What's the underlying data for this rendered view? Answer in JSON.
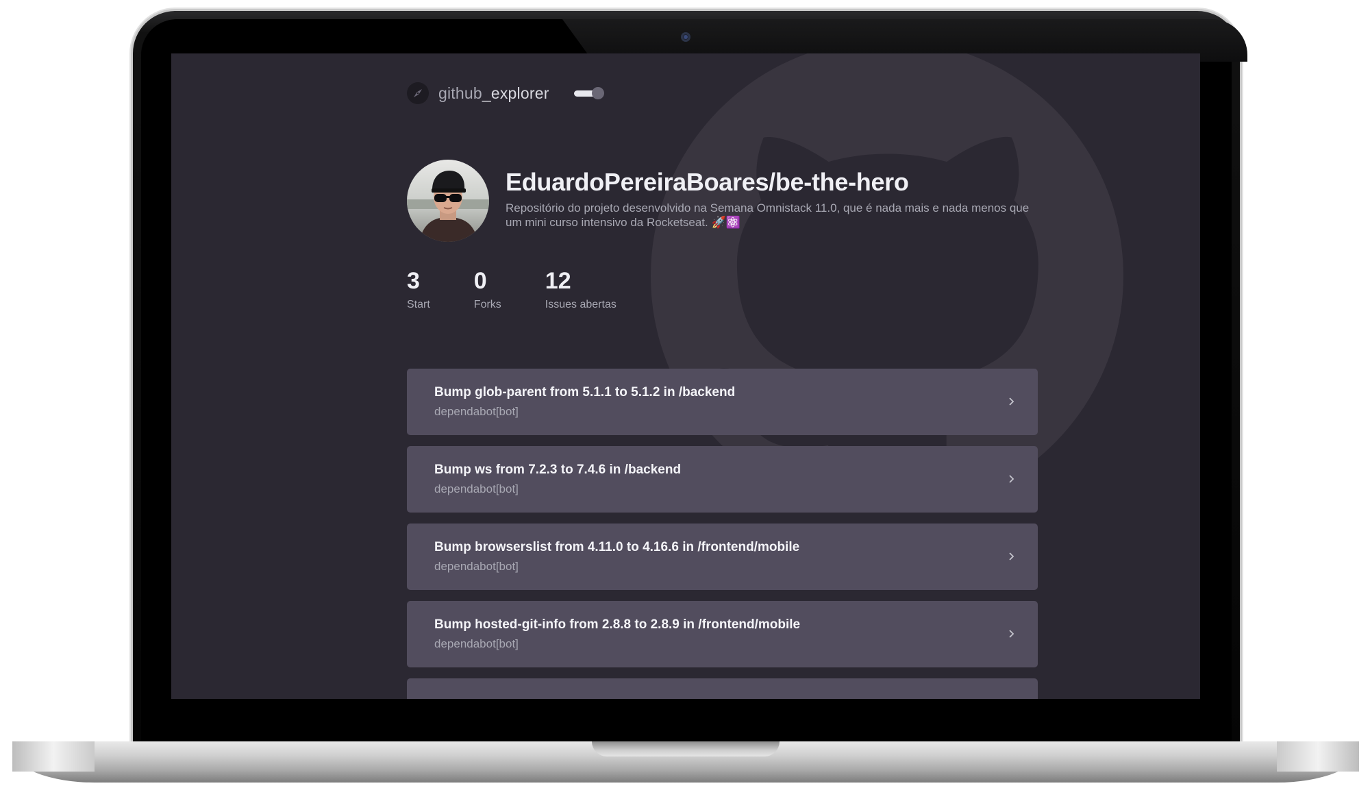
{
  "app": {
    "brand_prefix": "github",
    "brand_suffix": "_explorer",
    "theme_toggle_on": true
  },
  "repository": {
    "full_name": "EduardoPereiraBoares/be-the-hero",
    "description": "Repositório do projeto desenvolvido na Semana Omnistack 11.0, que é nada mais e nada menos que um mini curso intensivo da Rocketseat. 🚀⚛️"
  },
  "stats": [
    {
      "value": "3",
      "label": "Start"
    },
    {
      "value": "0",
      "label": "Forks"
    },
    {
      "value": "12",
      "label": "Issues abertas"
    }
  ],
  "issues": [
    {
      "title": "Bump glob-parent from 5.1.1 to 5.1.2 in /backend",
      "user": "dependabot[bot]"
    },
    {
      "title": "Bump ws from 7.2.3 to 7.4.6 in /backend",
      "user": "dependabot[bot]"
    },
    {
      "title": "Bump browserslist from 4.11.0 to 4.16.6 in /frontend/mobile",
      "user": "dependabot[bot]"
    },
    {
      "title": "Bump hosted-git-info from 2.8.8 to 2.8.9 in /frontend/mobile",
      "user": "dependabot[bot]"
    },
    {
      "title": "",
      "user": ""
    }
  ],
  "icons": {
    "logo": "compass-icon",
    "issue_arrow": "chevron-right-icon",
    "background": "github-octocat-icon"
  },
  "colors": {
    "background": "#2b2832",
    "card": "#524d5e",
    "text_primary": "#f0f0f5",
    "text_secondary": "#a8a8b3"
  }
}
